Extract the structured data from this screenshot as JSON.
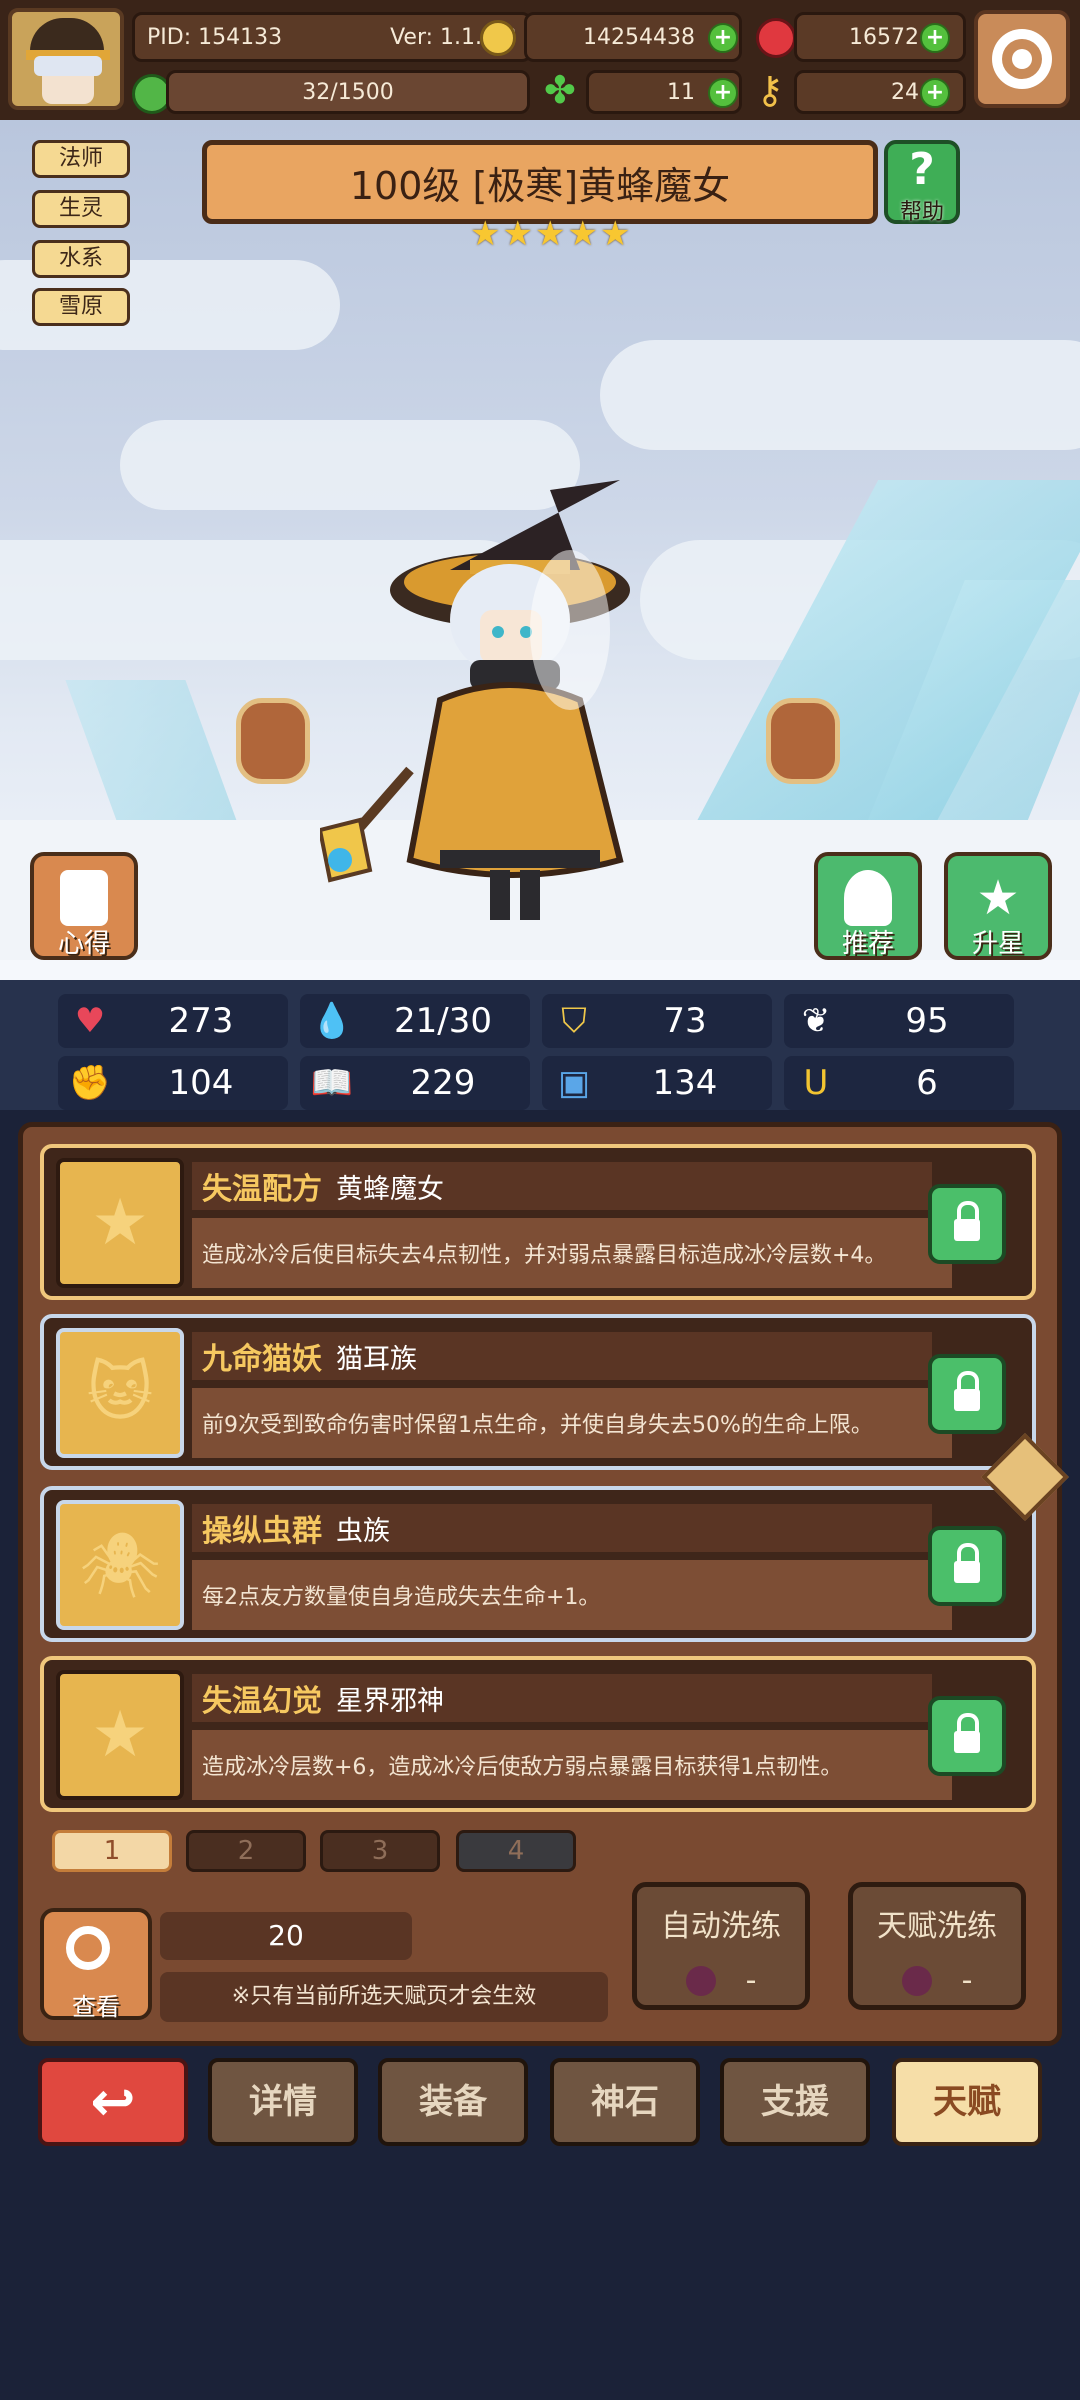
{
  "topbar": {
    "pid": "PID: 154133",
    "version": "Ver: 1.1.1.3",
    "gold": "14254438",
    "gems": "16572",
    "energy": "32/1500",
    "clover": "11",
    "keys": "24"
  },
  "hero": {
    "tags": [
      "法师",
      "生灵",
      "水系",
      "雪原"
    ],
    "title": "100级 [极寒]黄蜂魔女",
    "stars": 5,
    "help_label": "帮助",
    "left_button": "心得",
    "recommend_button": "推荐",
    "upgrade_button": "升星"
  },
  "stats": {
    "hp": "273",
    "mana": "21/30",
    "armor": "73",
    "speed": "95",
    "attack": "104",
    "magic": "229",
    "block": "134",
    "luck": "6"
  },
  "talents": [
    {
      "title": "失温配方",
      "subtitle": "黄蜂魔女",
      "desc": "造成冰冷后使目标失去4点韧性，并对弱点暴露目标造成冰冷层数+4。"
    },
    {
      "title": "九命猫妖",
      "subtitle": "猫耳族",
      "desc": "前9次受到致命伤害时保留1点生命，并使自身失去50%的生命上限。"
    },
    {
      "title": "操纵虫群",
      "subtitle": "虫族",
      "desc": "每2点友方数量使自身造成失去生命+1。"
    },
    {
      "title": "失温幻觉",
      "subtitle": "星界邪神",
      "desc": "造成冰冷层数+6，造成冰冷后使敌方弱点暴露目标获得1点韧性。"
    }
  ],
  "pages": [
    "1",
    "2",
    "3",
    "4"
  ],
  "bottom_panel": {
    "view_label": "查看",
    "berry_count": "20",
    "note": "※只有当前所选天赋页才会生效",
    "auto_reroll": "自动洗练",
    "auto_cost": "-",
    "talent_reroll": "天赋洗练",
    "talent_cost": "-"
  },
  "nav": [
    "详情",
    "装备",
    "神石",
    "支援",
    "天赋"
  ],
  "colors": {
    "accent": "#f3d7a6",
    "panel": "#7a4a31",
    "green": "#4bbf6a",
    "red": "#e0483f"
  }
}
